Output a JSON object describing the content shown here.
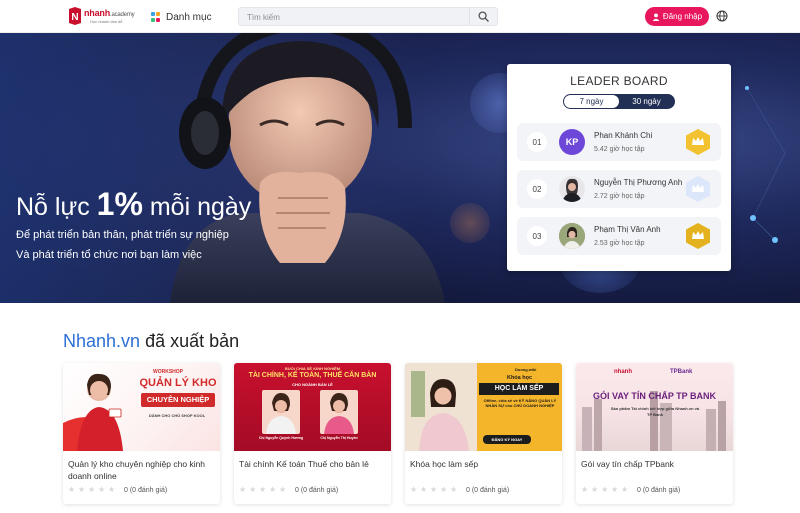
{
  "header": {
    "logo_text": "nhanh",
    "logo_suffix": ".academy",
    "logo_tagline": "Học nhanh làm dễ",
    "category_label": "Danh mục",
    "search_placeholder": "Tìm kiếm",
    "login_label": "Đăng nhập",
    "icons": {
      "category": "grid-icon",
      "search": "search-icon",
      "login": "user-icon",
      "language": "globe-icon"
    },
    "colors": {
      "login_bg": "#e8175d",
      "logo_red": "#c8102e"
    }
  },
  "hero": {
    "title_prefix": "Nỗ lực",
    "title_highlight": "1%",
    "title_suffix": "mỗi ngày",
    "subtitle_1": "Để phát triển bản thân, phát triển sự nghiệp",
    "subtitle_2": "Và phát triển tổ chức nơi bạn làm việc"
  },
  "leaderboard": {
    "title": "LEADER BOARD",
    "tabs": [
      {
        "label": "7 ngày",
        "active": true
      },
      {
        "label": "30 ngày",
        "active": false
      }
    ],
    "entries": [
      {
        "rank": "01",
        "initials": "KP",
        "name": "Phan Khánh Chi",
        "hours": "5.42 giờ học tập",
        "badge_color": "#f2c230"
      },
      {
        "rank": "02",
        "initials": "",
        "name": "Nguyễn Thị Phương Anh",
        "hours": "2.72 giờ học tập",
        "badge_color": "#dde7fb"
      },
      {
        "rank": "03",
        "initials": "",
        "name": "Phạm Thị Vân Anh",
        "hours": "2.53 giờ học tập",
        "badge_color": "#e3b21e"
      }
    ]
  },
  "section": {
    "title_brand": "Nhanh.vn",
    "title_rest": "đã xuất bản"
  },
  "courses": [
    {
      "name": "Quản lý kho chuyên nghiệp cho kinh doanh online",
      "rating": "0 (0 đánh giá)",
      "banner": {
        "kicker": "WORKSHOP",
        "line1": "QUẢN LÝ KHO",
        "line2": "CHUYÊN NGHIỆP",
        "line3": "DÀNH CHO CHỦ SHOP KOOL"
      }
    },
    {
      "name": "Tài chính Kế toán Thuế cho bản lẻ",
      "rating": "0 (0 đánh giá)",
      "banner": {
        "kicker": "BUỔI CHIA SẺ KINH NGHIỆM",
        "line1": "TÀI CHÍNH, KẾ TOÁN, THUẾ CĂN BẢN",
        "line2": "CHO NGÀNH BÁN LẺ",
        "speaker1": "Chị Nguyễn Quỳnh Hương",
        "speaker2": "Chị Nguyễn Thị Huyền"
      }
    },
    {
      "name": "Khóa học làm sếp",
      "rating": "0 (0 đánh giá)",
      "banner": {
        "kicker": "Khóa học",
        "line1": "HỌC LÀM SẾP",
        "line2": "Offline, chia sẻ về KỸ NĂNG QUẢN LÝ NHÂN SỰ cho CHỦ DOANH NGHIỆP",
        "cta": "ĐĂNG KÝ NGAY",
        "brand": "Duong.wiki"
      }
    },
    {
      "name": "Gói vay tín chấp TPbank",
      "rating": "0 (0 đánh giá)",
      "banner": {
        "line1": "GÓI VAY TÍN CHẤP TP BANK",
        "line2": "Sản phẩm Tài chính kết hợp giữa Nhanh.vn và TP Bank",
        "brand1": "nhanh",
        "brand2": "TPBank"
      }
    }
  ]
}
